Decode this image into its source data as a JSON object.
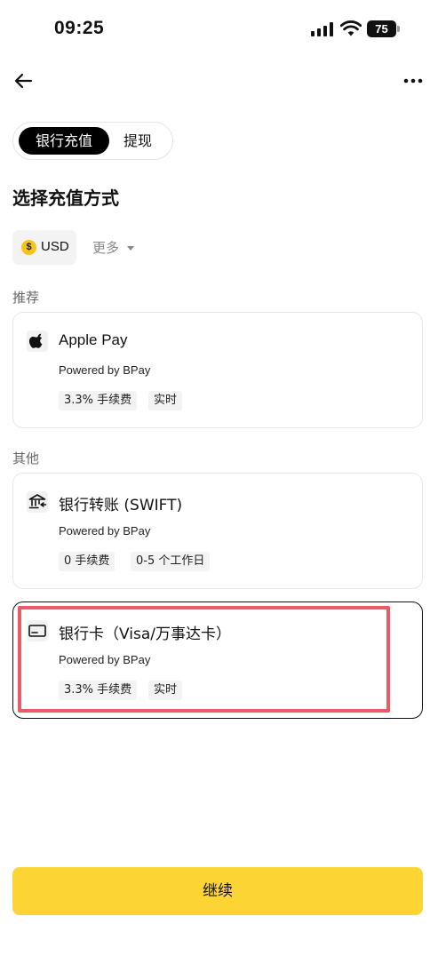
{
  "status_bar": {
    "time": "09:25",
    "battery": "75"
  },
  "header": {
    "back_icon": "arrow-left-icon",
    "more_icon": "more-horizontal-icon"
  },
  "tabs": [
    {
      "label": "银行充值",
      "active": true
    },
    {
      "label": "提现",
      "active": false
    }
  ],
  "page_title": "选择充值方式",
  "currency": {
    "symbol": "$",
    "label": "USD",
    "more_label": "更多"
  },
  "sections": {
    "recommended": "推荐",
    "other": "其他"
  },
  "methods": [
    {
      "icon": "apple-icon",
      "title": "Apple Pay",
      "subtitle": "Powered by BPay",
      "tags": [
        "3.3% 手续费",
        "实时"
      ],
      "selected": false
    },
    {
      "icon": "bank-icon",
      "title": "银行转账 (SWIFT)",
      "subtitle": "Powered by BPay",
      "tags": [
        "0 手续费",
        "0-5 个工作日"
      ],
      "selected": false
    },
    {
      "icon": "credit-card-icon",
      "title": "银行卡（Visa/万事达卡）",
      "subtitle": "Powered by BPay",
      "tags": [
        "3.3% 手续费",
        "实时"
      ],
      "selected": true
    }
  ],
  "continue_label": "继续",
  "colors": {
    "accent": "#fcd535",
    "highlight": "#ec5a6a",
    "tab_active": "#000000"
  }
}
